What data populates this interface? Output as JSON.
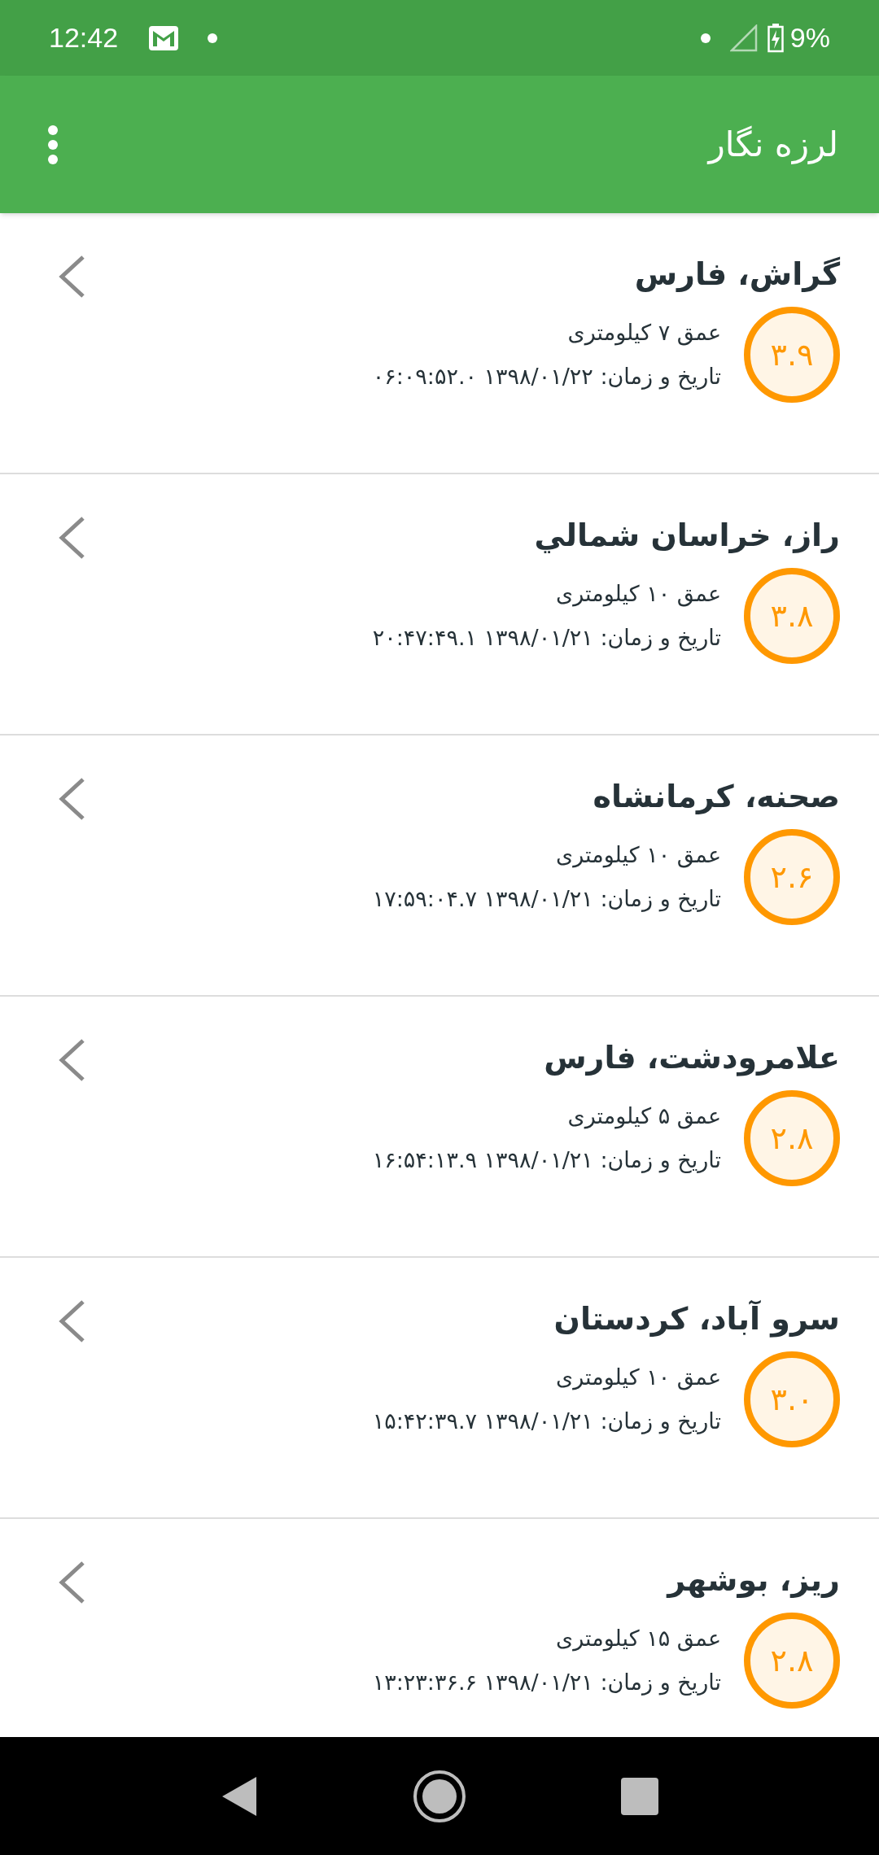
{
  "status_bar": {
    "time": "12:42",
    "battery": "9%"
  },
  "app_bar": {
    "title": "لرزه نگار"
  },
  "quakes": [
    {
      "place": "گراش، فارس",
      "magnitude": "۳.۹",
      "depth": "عمق ۷ کیلومتری",
      "datetime": "تاریخ و زمان: ۱۳۹۸/۰۱/۲۲ ۰۶:۰۹:۵۲.۰"
    },
    {
      "place": "راز، خراسان شمالي",
      "magnitude": "۳.۸",
      "depth": "عمق ۱۰ کیلومتری",
      "datetime": "تاریخ و زمان: ۱۳۹۸/۰۱/۲۱ ۲۰:۴۷:۴۹.۱"
    },
    {
      "place": "صحنه، کرمانشاه",
      "magnitude": "۲.۶",
      "depth": "عمق ۱۰ کیلومتری",
      "datetime": "تاریخ و زمان: ۱۳۹۸/۰۱/۲۱ ۱۷:۵۹:۰۴.۷"
    },
    {
      "place": "علامرودشت، فارس",
      "magnitude": "۲.۸",
      "depth": "عمق ۵ کیلومتری",
      "datetime": "تاریخ و زمان: ۱۳۹۸/۰۱/۲۱ ۱۶:۵۴:۱۳.۹"
    },
    {
      "place": "سرو آباد، کردستان",
      "magnitude": "۳.۰",
      "depth": "عمق ۱۰ کیلومتری",
      "datetime": "تاریخ و زمان: ۱۳۹۸/۰۱/۲۱ ۱۵:۴۲:۳۹.۷"
    },
    {
      "place": "ریز، بوشهر",
      "magnitude": "۲.۸",
      "depth": "عمق ۱۵ کیلومتری",
      "datetime": "تاریخ و زمان: ۱۳۹۸/۰۱/۲۱ ۱۳:۲۳:۳۶.۶"
    }
  ]
}
